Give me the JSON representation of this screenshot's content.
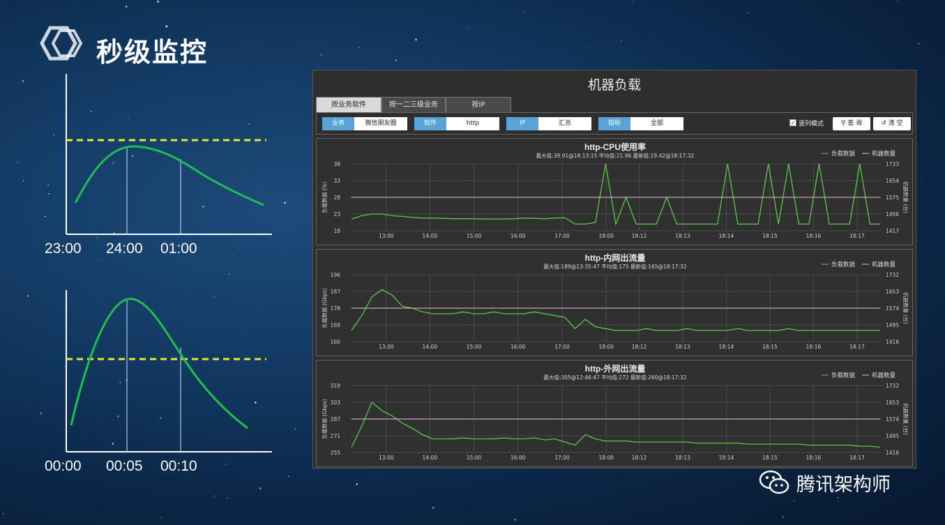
{
  "slide": {
    "title": "秒级监控",
    "watermark": "腾讯架构师"
  },
  "left_charts": [
    {
      "time_labels": [
        "23:00",
        "24:00",
        "01:00"
      ]
    },
    {
      "time_labels": [
        "00:00",
        "00:05",
        "00:10"
      ]
    }
  ],
  "dashboard": {
    "title": "机器负载",
    "tabs": [
      {
        "label": "按业务软件",
        "active": true
      },
      {
        "label": "按一二三级业务",
        "active": false
      },
      {
        "label": "按IP",
        "active": false
      }
    ],
    "filters": [
      {
        "label": "业务",
        "value": "微信朋友圈"
      },
      {
        "label": "软件",
        "value": "http"
      },
      {
        "label": "IP",
        "value": "汇总"
      },
      {
        "label": "指标",
        "value": "全部"
      }
    ],
    "parallel_mode": {
      "label": "竖列模式",
      "checked": true
    },
    "query_button": "查 询",
    "clear_button": "清 空",
    "colors": {
      "load": "#5bc84a",
      "machines": "#f2b8e8",
      "accent": "#5aa3d6"
    }
  },
  "chart_data": [
    {
      "type": "line",
      "title": "http-CPU使用率",
      "subtitle": "最大值:39.91@18:13:15 平均值:21.96 最新值:19.42@18:17:32",
      "ylabel": "负载数据 (%)",
      "y2label": "机器数量 (台)",
      "legend": [
        "负载数据",
        "机器数量"
      ],
      "legend_position": "top-right",
      "grid": true,
      "yticks": [
        "38",
        "33",
        "28",
        "23",
        "18"
      ],
      "y2ticks": [
        "1733",
        "1654",
        "1575",
        "1496",
        "1417"
      ],
      "xticks": [
        "13:00",
        "14:00",
        "15:00",
        "16:00",
        "17:00",
        "18:00",
        "18:12",
        "18:13",
        "18:14",
        "18:15",
        "18:16",
        "18:17"
      ],
      "ylim": [
        18,
        38
      ],
      "y2lim": [
        1417,
        1733
      ],
      "series": [
        {
          "name": "负载数据",
          "values": [
            21.5,
            22.5,
            23,
            23,
            22.5,
            22.3,
            22,
            21.8,
            21.8,
            21.7,
            21.6,
            21.6,
            21.6,
            21.5,
            21.5,
            21.5,
            21.6,
            21.8,
            21.7,
            21.6,
            21.8,
            21.9,
            20,
            20,
            20.5,
            38,
            20,
            28,
            20,
            20,
            20,
            28,
            20,
            20,
            20,
            20,
            20,
            38,
            20,
            20,
            20,
            38,
            20,
            38,
            20,
            20,
            38,
            20,
            20,
            20,
            38,
            20,
            20
          ]
        },
        {
          "name": "机器数量",
          "values": [
            1575,
            1575,
            1575,
            1575,
            1575,
            1575,
            1575,
            1575,
            1575,
            1575,
            1575,
            1575,
            1575,
            1575,
            1575,
            1575,
            1575,
            1575,
            1575,
            1575,
            1575,
            1575,
            1575,
            1575,
            1575,
            1575,
            1575,
            1575,
            1575,
            1575,
            1575,
            1575,
            1575,
            1575,
            1575,
            1575,
            1575,
            1575,
            1575,
            1575,
            1575,
            1575,
            1575,
            1575,
            1575,
            1575,
            1575,
            1575,
            1575,
            1575,
            1575,
            1575,
            1575
          ]
        }
      ]
    },
    {
      "type": "line",
      "title": "http-内网出流量",
      "subtitle": "最大值:189@13:35:47 平均值:175 最新值:165@18:17:32",
      "ylabel": "负载数据 (Gbps)",
      "y2label": "机器数量 (台)",
      "legend": [
        "负载数据",
        "机器数量"
      ],
      "legend_position": "top-right",
      "grid": true,
      "yticks": [
        "196",
        "187",
        "178",
        "169",
        "160"
      ],
      "y2ticks": [
        "1732",
        "1653",
        "1574",
        "1495",
        "1416"
      ],
      "xticks": [
        "13:00",
        "14:00",
        "15:00",
        "16:00",
        "17:00",
        "18:00",
        "18:12",
        "18:13",
        "18:14",
        "18:15",
        "18:16",
        "18:17"
      ],
      "ylim": [
        160,
        196
      ],
      "y2lim": [
        1416,
        1732
      ],
      "series": [
        {
          "name": "负载数据",
          "values": [
            166,
            174,
            184,
            188,
            185,
            179,
            178,
            176,
            175,
            175,
            175,
            176,
            175,
            175,
            176,
            175,
            175,
            175,
            176,
            175,
            174,
            173,
            167,
            172,
            168,
            167,
            166,
            166,
            166,
            167,
            166,
            166,
            166,
            167,
            166,
            166,
            166,
            166,
            167,
            166,
            166,
            166,
            166,
            167,
            166,
            166,
            166,
            166,
            166,
            166,
            166,
            166,
            166
          ]
        },
        {
          "name": "机器数量",
          "values": [
            1574,
            1574,
            1574,
            1574,
            1574,
            1574,
            1574,
            1574,
            1574,
            1574,
            1574,
            1574,
            1574,
            1574,
            1574,
            1574,
            1574,
            1574,
            1574,
            1574,
            1574,
            1574,
            1574,
            1574,
            1574,
            1574,
            1574,
            1574,
            1574,
            1574,
            1574,
            1574,
            1574,
            1574,
            1574,
            1574,
            1574,
            1574,
            1574,
            1574,
            1574,
            1574,
            1574,
            1574,
            1574,
            1574,
            1574,
            1574,
            1574,
            1574,
            1574,
            1574,
            1574
          ]
        }
      ]
    },
    {
      "type": "line",
      "title": "http-外网出流量",
      "subtitle": "最大值:305@12:46:47 平均值:272 最新值:260@18:17:32",
      "ylabel": "负载数据 (Gbps)",
      "y2label": "机器数量 (台)",
      "legend": [
        "负载数据",
        "机器数量"
      ],
      "legend_position": "top-right",
      "grid": true,
      "yticks": [
        "319",
        "303",
        "287",
        "271",
        "255"
      ],
      "y2ticks": [
        "1732",
        "1653",
        "1574",
        "1495",
        "1416"
      ],
      "xticks": [
        "13:00",
        "14:00",
        "15:00",
        "16:00",
        "17:00",
        "18:00",
        "18:12",
        "18:13",
        "18:14",
        "18:15",
        "18:16",
        "18:17"
      ],
      "ylim": [
        255,
        319
      ],
      "y2lim": [
        1416,
        1732
      ],
      "series": [
        {
          "name": "负载数据",
          "values": [
            260,
            280,
            303,
            295,
            290,
            283,
            278,
            272,
            268,
            268,
            268,
            269,
            268,
            268,
            268,
            269,
            268,
            268,
            269,
            267,
            268,
            265,
            262,
            272,
            268,
            266,
            266,
            266,
            265,
            265,
            265,
            265,
            265,
            265,
            264,
            264,
            264,
            264,
            264,
            263,
            263,
            263,
            263,
            263,
            263,
            262,
            262,
            262,
            262,
            262,
            261,
            261,
            260
          ]
        },
        {
          "name": "机器数量",
          "values": [
            1574,
            1574,
            1574,
            1574,
            1574,
            1574,
            1574,
            1574,
            1574,
            1574,
            1574,
            1574,
            1574,
            1574,
            1574,
            1574,
            1574,
            1574,
            1574,
            1574,
            1574,
            1574,
            1574,
            1574,
            1574,
            1574,
            1574,
            1574,
            1574,
            1574,
            1574,
            1574,
            1574,
            1574,
            1574,
            1574,
            1574,
            1574,
            1574,
            1574,
            1574,
            1574,
            1574,
            1574,
            1574,
            1574,
            1574,
            1574,
            1574,
            1574,
            1574,
            1574,
            1574
          ]
        }
      ]
    }
  ]
}
